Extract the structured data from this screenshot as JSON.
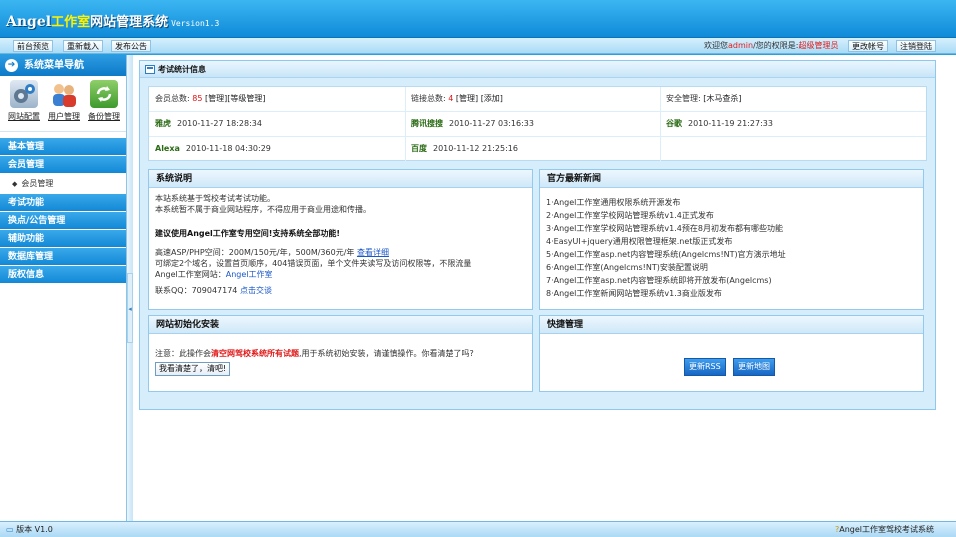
{
  "header": {
    "brand_angel": "Angel",
    "brand_studio": "工作室",
    "brand_title": "网站管理系统",
    "version": "Version1.3"
  },
  "toolbar": {
    "preview": "前台预览",
    "reload": "重新载入",
    "publish": "发布公告",
    "welcome_prefix": "欢迎您",
    "username": "admin",
    "welcome_mid": "/您的权限是:",
    "role": "超级管理员",
    "change_account": "更改帐号",
    "logout": "注销登陆"
  },
  "sidebar": {
    "title": "系统菜单导航",
    "quick": [
      {
        "label": "网站配置",
        "icon": "gear-icon"
      },
      {
        "label": "用户管理",
        "icon": "users-icon"
      },
      {
        "label": "备份管理",
        "icon": "backup-icon"
      }
    ],
    "menus": [
      "基本管理",
      "会员管理",
      "考试功能",
      "换点/公告管理",
      "辅助功能",
      "数据库管理",
      "版权信息"
    ],
    "submenu": "会员管理"
  },
  "stats": {
    "title": "考试统计信息",
    "members_label": "会员总数:",
    "members_count": "85",
    "members_manage": "[管理]",
    "level_manage": "[等级管理]",
    "links_label": "链接总数:",
    "links_count": "4",
    "links_manage": "[管理]",
    "links_add": "[添加]",
    "security_label": "安全管理:",
    "security_value": "[木马查杀]",
    "spiders": [
      {
        "name": "雅虎",
        "time": "2010-11-27 18:28:34"
      },
      {
        "name": "腾讯搜搜",
        "time": "2010-11-27 03:16:33"
      },
      {
        "name": "谷歌",
        "time": "2010-11-19 21:27:33"
      },
      {
        "name": "Alexa",
        "time": "2010-11-18 04:30:29"
      },
      {
        "name": "百度",
        "time": "2010-11-12 21:25:16"
      }
    ]
  },
  "sysinfo": {
    "title": "系统说明",
    "line1": "本站系统基于驾校考试考试功能。",
    "line2": "本系统暂不属于商业网站程序，不得应用于商业用途和传播。",
    "recommend": "建议使用Angel工作室专用空间!支持系统全部功能!",
    "host_line": "高速ASP/PHP空间：200M/150元/年，500M/360元/年",
    "host_link": "查看详细",
    "bind_line": "可绑定2个域名，设置首页顺序，404错误页面，单个文件夹读写及访问权限等，不限流量",
    "site_label": "Angel工作室网站：",
    "site_link": "Angel工作室",
    "qq_label": "联系QQ：709047174",
    "qq_link": "点击交谈"
  },
  "news": {
    "title": "官方最新新闻",
    "items": [
      "1·Angel工作室通用权限系统开源发布",
      "2·Angel工作室学校网站管理系统v1.4正式发布",
      "3·Angel工作室学校网站管理系统v1.4预在8月初发布都有哪些功能",
      "4·EasyUI+jquery通用权限管理框架.net版正式发布",
      "5·Angel工作室asp.net内容管理系统(Angelcms!NT)官方演示地址",
      "6·Angel工作室(Angelcms!NT)安装配置说明",
      "7·Angel工作室asp.net内容管理系统即将开放发布(Angelcms)",
      "8·Angel工作室新闻网站管理系统v1.3商业版发布"
    ]
  },
  "init": {
    "title": "网站初始化安装",
    "note_prefix": "注意：此操作会",
    "note_red": "清空网驾校系统所有试题",
    "note_suffix": ",用于系统初始安装，请谨慎操作。你看清楚了吗?",
    "button": "我看清楚了，清吧!"
  },
  "quick_manage": {
    "title": "快捷管理",
    "rss": "更新RSS",
    "sitemap": "更新地图"
  },
  "statusbar": {
    "version": "版本 V1.0",
    "copyright": "Angel工作室驾校考试系统"
  },
  "colors": {
    "header": "#1797e0",
    "menu": "#1e8fda",
    "accent_red": "#e01a1a"
  }
}
